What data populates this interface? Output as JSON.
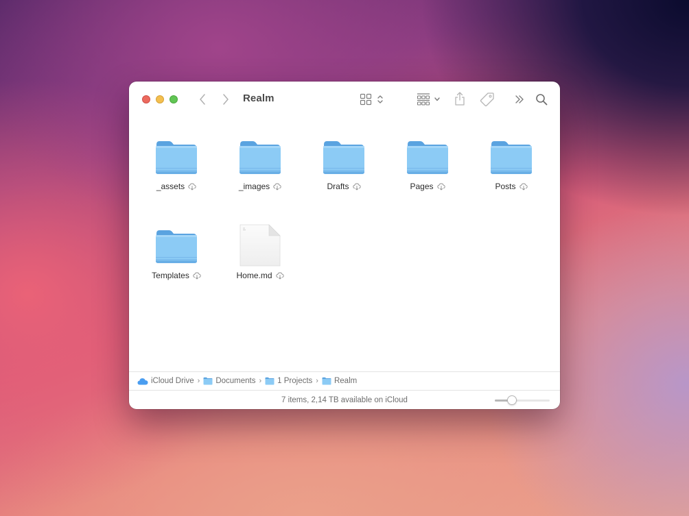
{
  "window": {
    "title": "Realm",
    "traffic_lights": {
      "close": "#ec6a5e",
      "minimize": "#f4bf4f",
      "zoom": "#61c554"
    }
  },
  "toolbar": {
    "back": "chevron-left-icon",
    "forward": "chevron-right-icon",
    "view_mode": "icon-grid-view",
    "group_by": "group-icon",
    "share": "share-icon",
    "tags": "tag-icon",
    "more": "double-chevron-right-icon",
    "search": "search-icon"
  },
  "items": [
    {
      "name": "_assets",
      "type": "folder",
      "icloud": true
    },
    {
      "name": "_images",
      "type": "folder",
      "icloud": true
    },
    {
      "name": "Drafts",
      "type": "folder",
      "icloud": true
    },
    {
      "name": "Pages",
      "type": "folder",
      "icloud": true
    },
    {
      "name": "Posts",
      "type": "folder",
      "icloud": true
    },
    {
      "name": "Templates",
      "type": "folder",
      "icloud": true
    },
    {
      "name": "Home.md",
      "type": "file",
      "icloud": true
    }
  ],
  "pathbar": {
    "crumbs": [
      {
        "label": "iCloud Drive",
        "icon": "icloud-icon"
      },
      {
        "label": "Documents",
        "icon": "folder-icon"
      },
      {
        "label": "1 Projects",
        "icon": "folder-icon"
      },
      {
        "label": "Realm",
        "icon": "folder-icon"
      }
    ],
    "separator": "›"
  },
  "status": {
    "text": "7 items, 2,14 TB available on iCloud",
    "icon_size_fraction": 0.28
  },
  "colors": {
    "folder_light": "#8ccbf5",
    "folder_dark": "#5aa3e0",
    "accent": "#1a8cff"
  }
}
